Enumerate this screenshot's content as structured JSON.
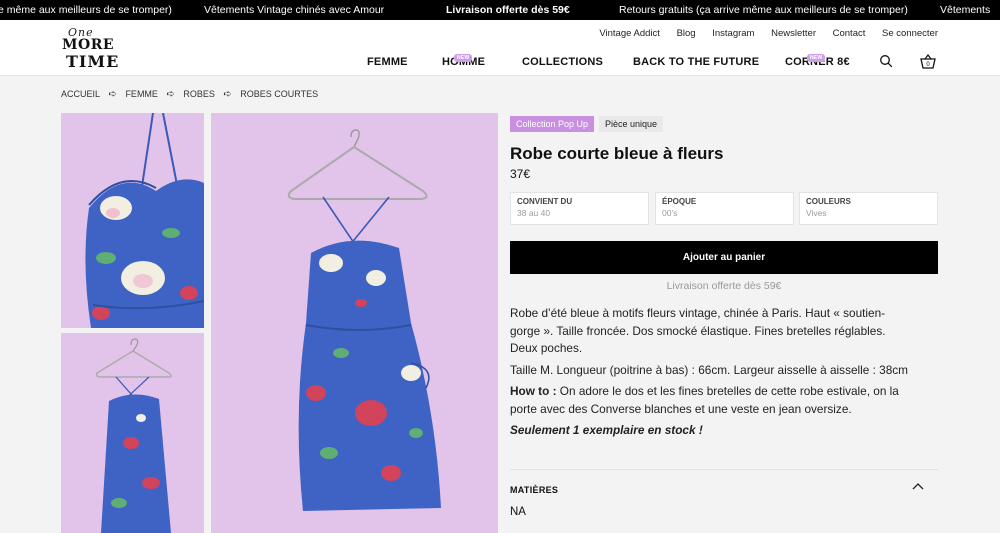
{
  "marquee": {
    "items": [
      "e même aux meilleurs de se tromper)",
      "Vêtements Vintage chinés avec Amour",
      "Livraison offerte dès 59€",
      "Retours gratuits (ça arrive même aux meilleurs de se tromper)",
      "Vêtements"
    ]
  },
  "logo": {
    "script": "One",
    "line1": "MORE",
    "line2": "TIME"
  },
  "topnav": [
    "Vintage Addict",
    "Blog",
    "Instagram",
    "Newsletter",
    "Contact",
    "Se connecter"
  ],
  "mainnav": {
    "femme": "FEMME",
    "homme": "HOMME",
    "homme_pill": "NEW",
    "collections": "COLLECTIONS",
    "back": "BACK TO THE FUTURE",
    "corner": "CORNER 8€",
    "corner_pill": "NEW"
  },
  "cart_count": "0",
  "breadcrumb": [
    "ACCUEIL",
    "FEMME",
    "ROBES",
    "ROBES COURTES"
  ],
  "product": {
    "badge_collection": "Collection Pop Up",
    "badge_unique": "Pièce unique",
    "title": "Robe courte bleue à fleurs",
    "price": "37€",
    "specs": [
      {
        "label": "CONVIENT DU",
        "value": "38 au 40"
      },
      {
        "label": "ÉPOQUE",
        "value": "00's"
      },
      {
        "label": "COULEURS",
        "value": "Vives"
      }
    ],
    "add_to_cart": "Ajouter au panier",
    "shipping": "Livraison offerte dès 59€",
    "desc1": "Robe d’été bleue à motifs fleurs vintage, chinée à Paris. Haut « soutien-gorge ». Taille froncée. Dos smocké élastique. Fines bretelles réglables. Deux poches.",
    "desc2": "Taille M. Longueur (poitrine à bas) : 66cm. Largeur aisselle à aisselle : 38cm",
    "howto_label": "How to :",
    "howto_text": " On adore le dos et les fines bretelles de cette robe estivale, on la porte avec des Converse blanches et une veste en jean oversize.",
    "stock": "Seulement 1 exemplaire en stock !",
    "materials_label": "MATIÈRES",
    "materials_value": "NA"
  },
  "colors": {
    "accent": "#c98fe0",
    "lilac_bg": "#e2c3ea",
    "dress_blue": "#3f63c4"
  }
}
